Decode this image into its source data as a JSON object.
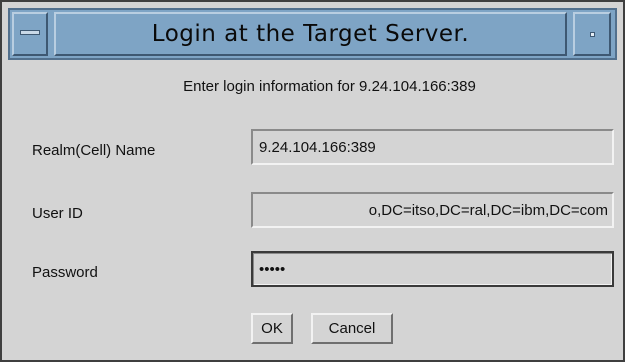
{
  "dialog": {
    "title": "Login at the Target Server.",
    "prompt": "Enter login information for 9.24.104.166:389",
    "fields": [
      {
        "label": "Realm(Cell) Name",
        "value": "9.24.104.166:389"
      },
      {
        "label": "User ID",
        "value": "o,DC=itso,DC=ral,DC=ibm,DC=com"
      },
      {
        "label": "Password",
        "value": "zzzzz"
      }
    ],
    "buttons": {
      "ok": "OK",
      "cancel": "Cancel"
    }
  },
  "icons": {
    "window_menu": "window-menu-icon",
    "minimize": "minimize-icon"
  },
  "colors": {
    "window_bg": "#d4d4d4",
    "titlebar": "#7ea4c5"
  }
}
